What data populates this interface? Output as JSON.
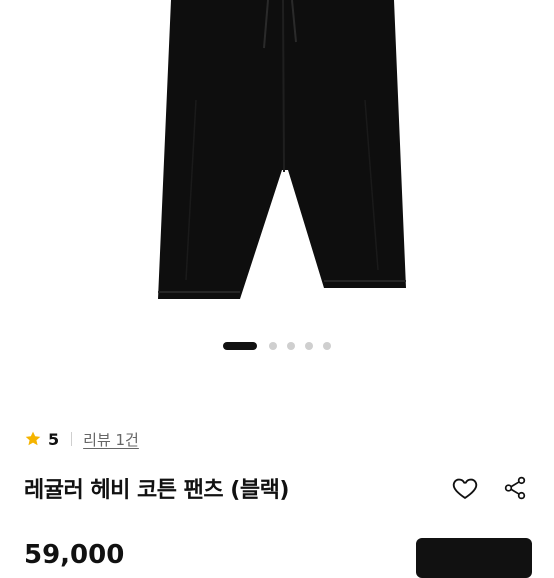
{
  "product": {
    "rating": "5",
    "review_link": "리뷰 1건",
    "title": "레귤러 헤비 코튼 팬츠 (블랙)",
    "price": "59,000"
  },
  "carousel": {
    "total": 5,
    "active_index": 0
  },
  "icons": {
    "rating": "star-icon",
    "wishlist": "heart-icon",
    "share": "share-icon"
  },
  "colors": {
    "star": "#f5b400",
    "text": "#111111",
    "muted": "#666666",
    "dot_inactive": "#cfcfcf"
  }
}
